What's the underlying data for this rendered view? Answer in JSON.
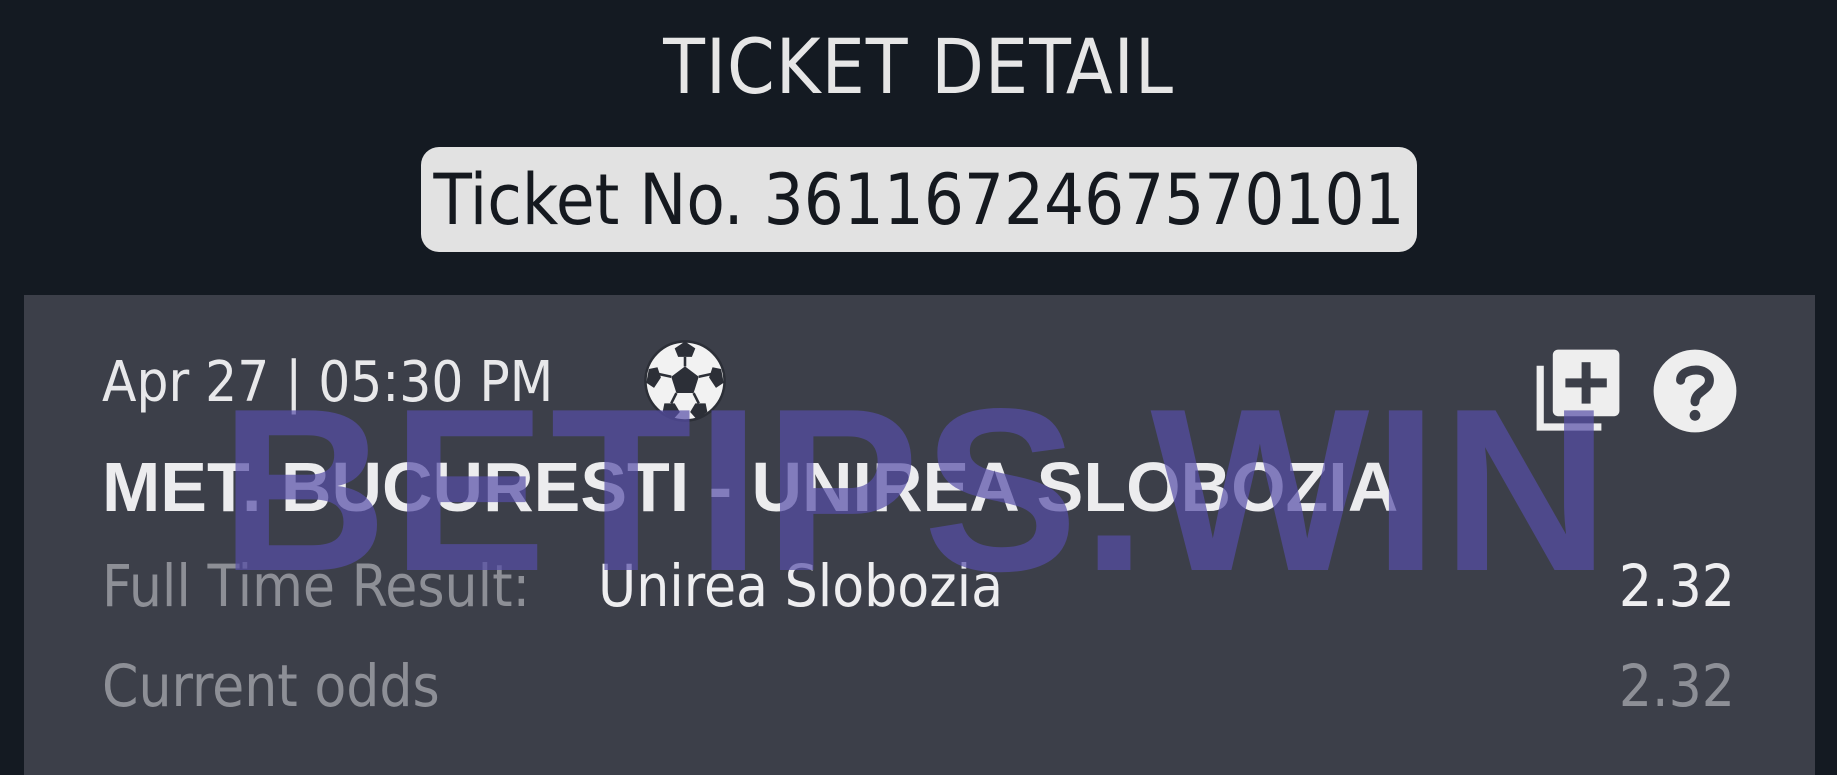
{
  "header": {
    "title": "TICKET DETAIL",
    "ticket_number": "Ticket No. 3611672467570101"
  },
  "watermark": "BETIPS.WIN",
  "event": {
    "datetime": "Apr 27 | 05:30 PM",
    "sport_icon": "soccer-ball-icon",
    "match": "MET. BUCURESTI - UNIREA SLOBOZIA",
    "market_label": "Full Time Result:",
    "selection": "Unirea Slobozia",
    "odds": "2.32",
    "current_odds_label": "Current odds",
    "current_odds": "2.32"
  },
  "icons": {
    "copy": "add-to-collection-icon",
    "help": "help-icon"
  },
  "colors": {
    "background": "#141a22",
    "card": "#3c3f49",
    "pill": "#e2e2e2",
    "watermark": "#564ea8",
    "muted_text": "#8d8f96"
  }
}
